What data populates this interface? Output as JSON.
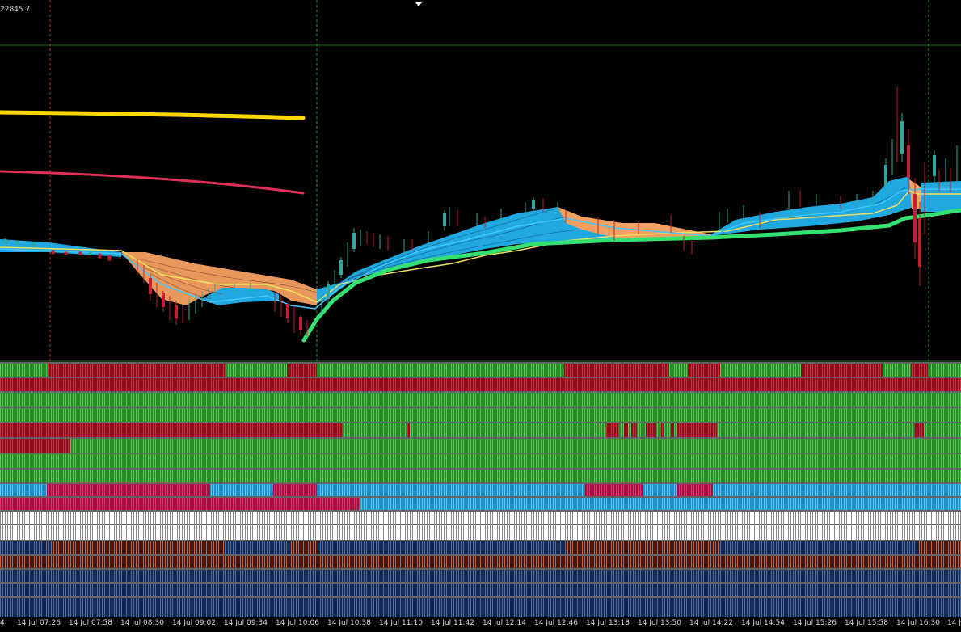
{
  "header": {
    "price_readout": "22845.7"
  },
  "colors": {
    "background": "#000000",
    "bull_green": "#2fa82f",
    "bear_red": "#b0102a",
    "sky_blue": "#20a8e0",
    "orange_ribbon": "#f4a060",
    "yellow_ma": "#ffd700",
    "pink_ma": "#e0305a",
    "lime_ma": "#33e070",
    "grid_green": "#2e8b2e",
    "grid_red": "#a03020",
    "navy": "#1a2a5a",
    "white": "#ffffff"
  },
  "time_axis": {
    "labels": [
      "14 Jul 07:26",
      "14 Jul 07:58",
      "14 Jul 08:30",
      "14 Jul 09:02",
      "14 Jul 09:34",
      "14 Jul 10:06",
      "14 Jul 10:38",
      "14 Jul 11:10",
      "14 Jul 11:42",
      "14 Jul 12:14",
      "14 Jul 12:46",
      "14 Jul 13:18",
      "14 Jul 13:50",
      "14 Jul 14:22",
      "14 Jul 14:54",
      "14 Jul 15:26",
      "14 Jul 15:58",
      "14 Jul 16:30"
    ],
    "leading_fragment": "4",
    "trailing_fragment": "14 J"
  },
  "indicator_rows": [
    {
      "name": "trend-row-1",
      "segments": [
        [
          "green",
          0,
          60
        ],
        [
          "red",
          60,
          280
        ],
        [
          "green",
          280,
          355
        ],
        [
          "red",
          355,
          392
        ],
        [
          "green",
          392,
          698
        ],
        [
          "red",
          698,
          828
        ],
        [
          "green",
          828,
          851
        ],
        [
          "red",
          851,
          891
        ],
        [
          "green",
          891,
          991
        ],
        [
          "red",
          991,
          1092
        ],
        [
          "green",
          1092,
          1127
        ],
        [
          "red",
          1127,
          1148
        ],
        [
          "green",
          1148,
          1189
        ]
      ]
    },
    {
      "name": "trend-row-2",
      "segments": [
        [
          "red",
          0,
          1189
        ]
      ]
    },
    {
      "name": "trend-row-3",
      "segments": [
        [
          "green",
          0,
          1189
        ]
      ]
    },
    {
      "name": "trend-row-4",
      "segments": [
        [
          "green",
          0,
          1189
        ]
      ]
    },
    {
      "name": "trend-row-5",
      "segments": [
        [
          "red",
          0,
          424
        ],
        [
          "green",
          424,
          504
        ],
        [
          "red",
          504,
          507
        ],
        [
          "green",
          507,
          750
        ],
        [
          "red",
          750,
          766
        ],
        [
          "green",
          766,
          772
        ],
        [
          "red",
          772,
          777
        ],
        [
          "green",
          777,
          781
        ],
        [
          "red",
          781,
          788
        ],
        [
          "green",
          788,
          799
        ],
        [
          "red",
          799,
          812
        ],
        [
          "green",
          812,
          818
        ],
        [
          "red",
          818,
          822
        ],
        [
          "green",
          822,
          830
        ],
        [
          "red",
          830,
          834
        ],
        [
          "green",
          834,
          838
        ],
        [
          "red",
          838,
          887
        ],
        [
          "green",
          887,
          1131
        ],
        [
          "red",
          1131,
          1143
        ],
        [
          "green",
          1143,
          1189
        ]
      ]
    },
    {
      "name": "trend-row-6",
      "segments": [
        [
          "red",
          0,
          87
        ],
        [
          "green",
          87,
          1189
        ]
      ]
    },
    {
      "name": "trend-row-7",
      "segments": [
        [
          "green",
          0,
          1189
        ]
      ]
    },
    {
      "name": "trend-row-8",
      "segments": [
        [
          "green",
          0,
          1189
        ]
      ]
    },
    {
      "name": "trend-row-9",
      "segments": [
        [
          "blue",
          0,
          58
        ],
        [
          "crimson",
          58,
          260
        ],
        [
          "blue",
          260,
          338
        ],
        [
          "crimson",
          338,
          392
        ],
        [
          "blue",
          392,
          723
        ],
        [
          "crimson",
          723,
          795
        ],
        [
          "blue",
          795,
          838
        ],
        [
          "crimson",
          838,
          882
        ],
        [
          "blue",
          882,
          1189
        ]
      ]
    },
    {
      "name": "trend-row-10",
      "segments": [
        [
          "crimson",
          0,
          446
        ],
        [
          "blue",
          446,
          1189
        ]
      ]
    },
    {
      "name": "trend-row-11",
      "segments": [
        [
          "white",
          0,
          1189
        ]
      ]
    },
    {
      "name": "trend-row-12",
      "segments": [
        [
          "white",
          0,
          1189
        ]
      ]
    },
    {
      "name": "trend-row-13",
      "segments": [
        [
          "navy",
          0,
          63
        ],
        [
          "brown",
          63,
          278
        ],
        [
          "navy",
          278,
          360
        ],
        [
          "brown",
          360,
          394
        ],
        [
          "navy",
          394,
          700
        ],
        [
          "brown",
          700,
          890
        ],
        [
          "navy",
          890,
          1135
        ],
        [
          "brown",
          1135,
          1189
        ]
      ]
    },
    {
      "name": "trend-row-14",
      "segments": [
        [
          "brown",
          0,
          1189
        ]
      ]
    },
    {
      "name": "trend-row-15",
      "segments": [
        [
          "navy",
          0,
          1189
        ]
      ]
    },
    {
      "name": "trend-row-16",
      "segments": [
        [
          "navy",
          0,
          1189
        ]
      ]
    },
    {
      "name": "trend-row-17",
      "segments": [
        [
          "navy",
          0,
          1189
        ]
      ]
    }
  ]
}
